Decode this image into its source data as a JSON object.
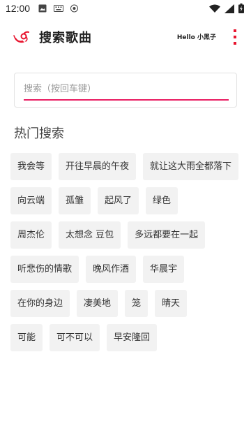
{
  "status_bar": {
    "time": "12:00",
    "icons": [
      "image-icon",
      "keyboard-icon",
      "shield-icon",
      "wifi-icon",
      "signal-icon",
      "battery-charging-icon"
    ]
  },
  "app_bar": {
    "logo_icon": "netease-music-logo-icon",
    "title": "搜索歌曲",
    "greeting": "Hello 小黑子",
    "menu_icon": "more-vert-icon",
    "accent_color": "#e8152f"
  },
  "search": {
    "placeholder": "搜索（按回车键）",
    "value": "",
    "underline_color": "#e91e63"
  },
  "hot_search": {
    "title": "热门搜索",
    "rows": [
      [
        "我会等",
        "开往早晨的午夜",
        "就让这大雨全都落下"
      ],
      [
        "向云端",
        "孤雏",
        "起风了",
        "绿色"
      ],
      [
        "周杰伦",
        "太想念 豆包",
        "多远都要在一起"
      ],
      [
        "听悲伤的情歌",
        "晚风作酒",
        "华晨宇"
      ],
      [
        "在你的身边",
        "凄美地",
        "笼",
        "晴天"
      ],
      [
        "可能",
        "可不可以",
        "早安隆回"
      ]
    ]
  }
}
